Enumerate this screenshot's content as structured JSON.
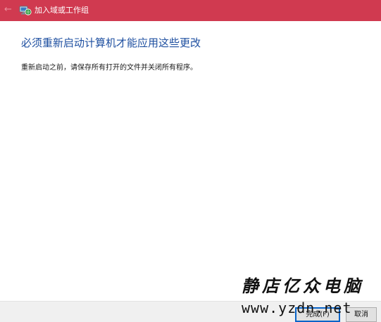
{
  "titlebar": {
    "title": "加入域或工作组",
    "back_icon": "back-arrow-icon",
    "app_icon": "network-computer-icon",
    "background": "#d03a50"
  },
  "content": {
    "heading": "必须重新启动计算机才能应用这些更改",
    "instruction": "重新启动之前，请保存所有打开的文件并关闭所有程序。",
    "heading_color": "#1e4fa0"
  },
  "footer": {
    "finish_label": "完成(F)",
    "cancel_label": "取消"
  },
  "watermark": {
    "name": "静店亿众电脑",
    "url": "www.yzdn.net"
  }
}
